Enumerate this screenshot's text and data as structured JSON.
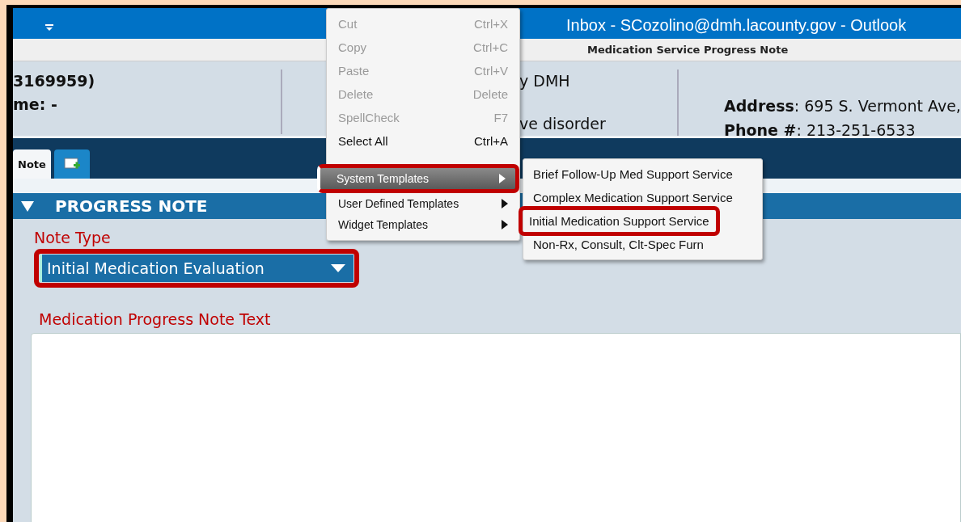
{
  "outlook_bar": {
    "title": "Inbox - SCozolino@dmh.lacounty.gov - Outlook"
  },
  "window": {
    "title": "Medication Service Progress Note"
  },
  "header": {
    "columns": [
      {
        "lines": [
          "3169959)",
          "**me**: -"
        ]
      },
      {
        "lines": [
          "y DMH",
          "ve disorder"
        ]
      },
      {
        "lines": [
          "**Address**: 695 S. Vermont Ave,",
          "**Phone #**: 213-251-6533"
        ]
      }
    ]
  },
  "tabs": [
    {
      "kind": "text",
      "label": "Note",
      "selected": true
    },
    {
      "kind": "add",
      "selected": false
    }
  ],
  "section": {
    "title": "PROGRESS NOTE",
    "expanded": true
  },
  "note_type": {
    "label": "Note Type",
    "value": "Initial Medication Evaluation",
    "highlighted": true
  },
  "text_label": "Medication Progress Note Text",
  "context_menu": {
    "items": [
      {
        "kind": "command",
        "label": "Cut",
        "shortcut": "Ctrl+X",
        "disabled": true
      },
      {
        "kind": "command",
        "label": "Copy",
        "shortcut": "Ctrl+C",
        "disabled": true
      },
      {
        "kind": "command",
        "label": "Paste",
        "shortcut": "Ctrl+V",
        "disabled": true
      },
      {
        "kind": "command",
        "label": "Delete",
        "shortcut": "Delete",
        "disabled": true
      },
      {
        "kind": "command",
        "label": "SpellCheck",
        "shortcut": "F7",
        "disabled": true
      },
      {
        "kind": "command",
        "label": "Select All",
        "shortcut": "Ctrl+A",
        "disabled": false
      },
      {
        "kind": "separator"
      },
      {
        "kind": "submenu",
        "label": "System Templates",
        "selected": true,
        "highlighted": true
      },
      {
        "kind": "submenu",
        "label": "User Defined Templates",
        "selected": false,
        "highlighted": false
      },
      {
        "kind": "submenu",
        "label": "Widget Templates",
        "selected": false,
        "highlighted": false
      }
    ]
  },
  "submenu": {
    "items": [
      {
        "label": "Brief Follow-Up Med Support Service",
        "highlighted": false
      },
      {
        "label": "Complex Medication Support Service",
        "highlighted": false
      },
      {
        "label": "Initial Medication Support Service",
        "highlighted": true
      },
      {
        "label": "Non-Rx, Consult, Clt-Spec Furn",
        "highlighted": false
      }
    ]
  }
}
